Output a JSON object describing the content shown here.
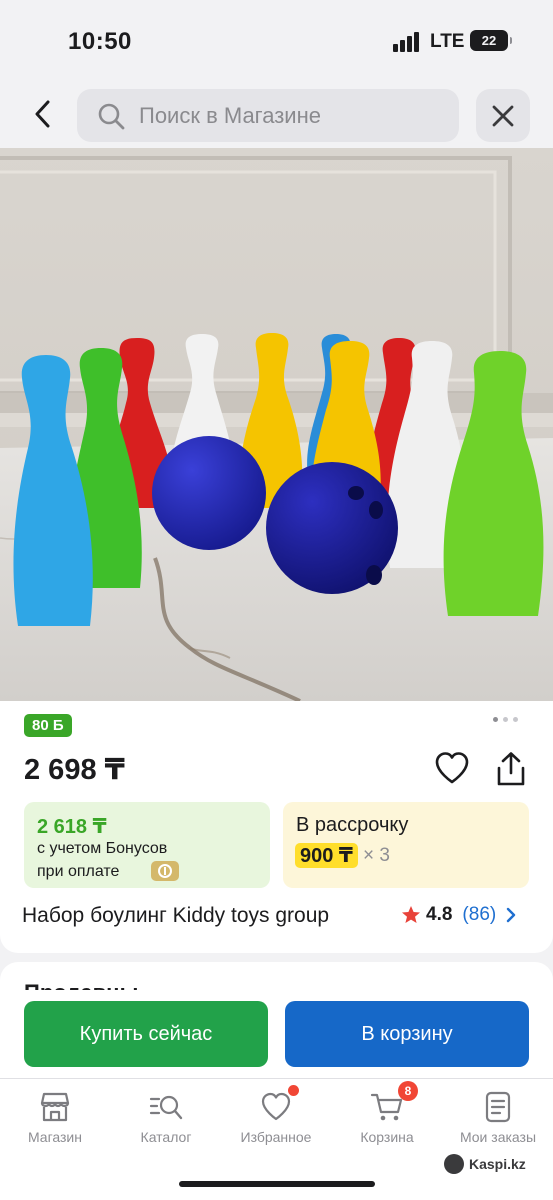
{
  "status_bar": {
    "time": "10:50",
    "network": "LTE",
    "battery": "22"
  },
  "search": {
    "placeholder": "Поиск в Магазине"
  },
  "product": {
    "bonus_badge": "80 Б",
    "price": "2 698 ₸",
    "bonus_price": "2 618 ₸",
    "bonus_line1": "с учетом Бонусов",
    "bonus_line2": "при оплате",
    "installment_label": "В рассрочку",
    "installment_amount": "900 ₸",
    "installment_multiplier": "× 3",
    "title": "Набор боулинг Kiddy toys group",
    "rating": "4.8",
    "reviews": "(86)",
    "image_count": 3,
    "active_image": 0
  },
  "next_section": {
    "title": "Продавцы"
  },
  "actions": {
    "buy_now": "Купить сейчас",
    "add_to_cart": "В корзину"
  },
  "tabs": [
    {
      "label": "Магазин",
      "icon": "store-icon"
    },
    {
      "label": "Каталог",
      "icon": "catalog-search-icon"
    },
    {
      "label": "Избранное",
      "icon": "heart-icon"
    },
    {
      "label": "Корзина",
      "icon": "cart-icon",
      "badge": "8"
    },
    {
      "label": "Мои заказы",
      "icon": "orders-icon"
    }
  ],
  "watermark": "Kaspi.kz",
  "colors": {
    "green": "#3aa628",
    "buy_button": "#22a24a",
    "cart_button": "#1668c8",
    "installment_highlight": "#ffde2b",
    "badge_red": "#f14635",
    "link_blue": "#1f6fd0"
  }
}
